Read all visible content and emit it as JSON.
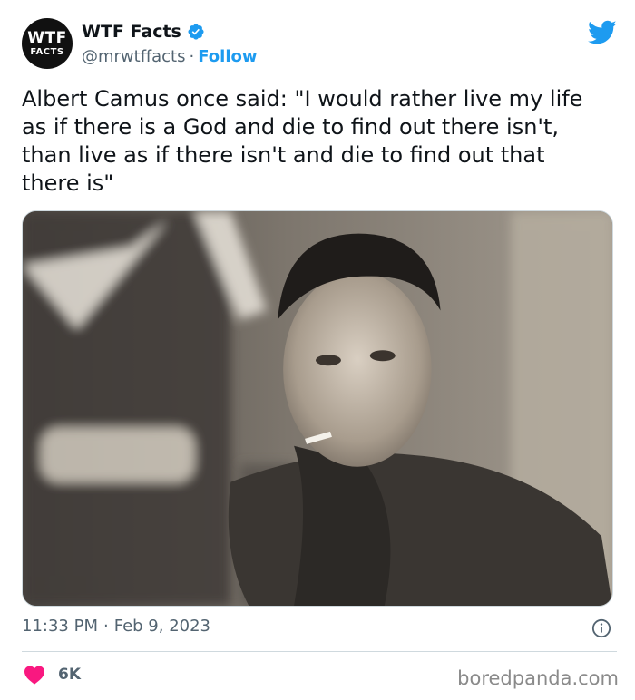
{
  "author": {
    "avatar_line1": "WTF",
    "avatar_line2": "FACTS",
    "display_name": "WTF Facts",
    "handle": "@mrwtffacts",
    "separator": "·",
    "follow_label": "Follow",
    "verified": true
  },
  "tweet": {
    "text": "Albert Camus once said: \"I would rather live my life as if there is a God and die to find out there isn't, than live as if there isn't and die to find out that there is\"",
    "time": "11:33 PM",
    "separator": "·",
    "date": "Feb 9, 2023",
    "likes": "6K"
  },
  "watermark": "boredpanda.com",
  "icons": {
    "verified": "verified-badge-icon",
    "twitter": "twitter-bird-icon",
    "info": "info-icon",
    "heart": "heart-icon"
  },
  "colors": {
    "brand_blue": "#1d9bf0",
    "like_red": "#f91880",
    "text": "#0f1419",
    "secondary": "#536471"
  }
}
